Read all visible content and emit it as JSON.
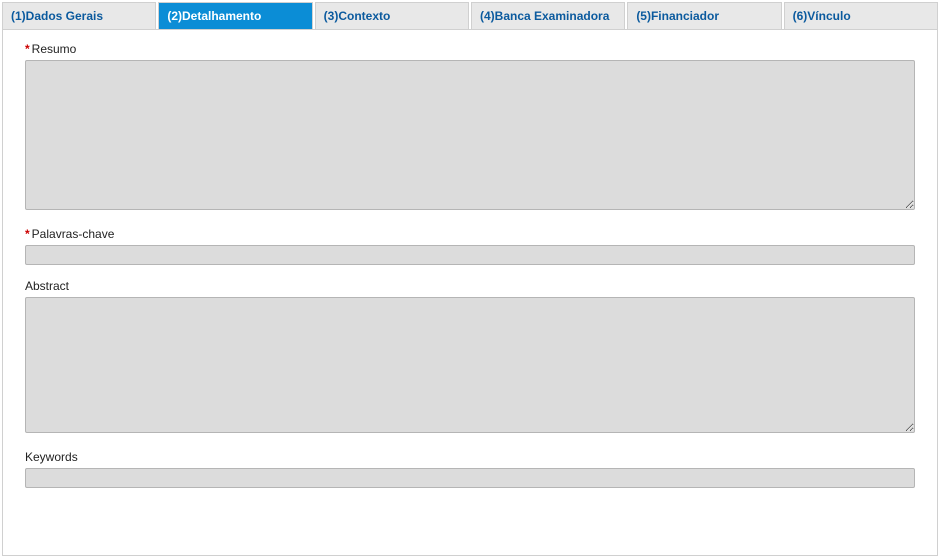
{
  "tabs": [
    {
      "label": "(1)Dados Gerais",
      "active": false
    },
    {
      "label": "(2)Detalhamento",
      "active": true
    },
    {
      "label": "(3)Contexto",
      "active": false
    },
    {
      "label": "(4)Banca Examinadora",
      "active": false
    },
    {
      "label": "(5)Financiador",
      "active": false
    },
    {
      "label": "(6)Vínculo",
      "active": false
    }
  ],
  "required_mark": "*",
  "fields": {
    "resumo": {
      "label": "Resumo",
      "required": true,
      "value": ""
    },
    "palavras_chave": {
      "label": "Palavras-chave",
      "required": true,
      "value": ""
    },
    "abstract": {
      "label": "Abstract",
      "required": false,
      "value": ""
    },
    "keywords": {
      "label": "Keywords",
      "required": false,
      "value": ""
    }
  }
}
